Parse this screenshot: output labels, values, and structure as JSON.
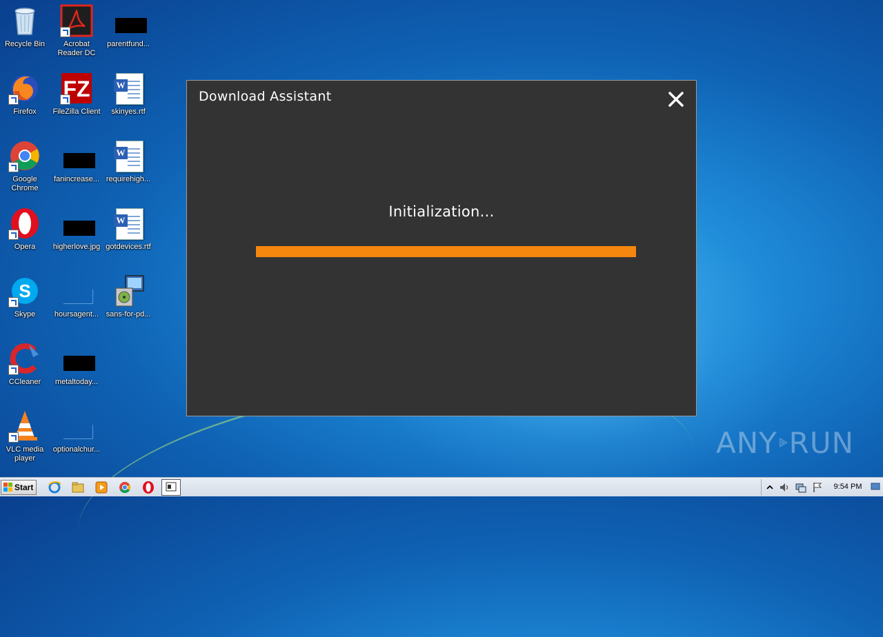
{
  "desktop": {
    "icons": [
      {
        "label": "Recycle Bin",
        "label2": ""
      },
      {
        "label": "Acrobat",
        "label2": "Reader DC"
      },
      {
        "label": "parentfund...",
        "label2": ""
      },
      {
        "label": "Firefox",
        "label2": ""
      },
      {
        "label": "FileZilla Client",
        "label2": ""
      },
      {
        "label": "skinyes.rtf",
        "label2": ""
      },
      {
        "label": "Google",
        "label2": "Chrome"
      },
      {
        "label": "fanincrease...",
        "label2": ""
      },
      {
        "label": "requirehigh...",
        "label2": ""
      },
      {
        "label": "Opera",
        "label2": ""
      },
      {
        "label": "higherlove.jpg",
        "label2": ""
      },
      {
        "label": "gotdevices.rtf",
        "label2": ""
      },
      {
        "label": "Skype",
        "label2": ""
      },
      {
        "label": "hoursagent...",
        "label2": ""
      },
      {
        "label": "sans-for-pd...",
        "label2": ""
      },
      {
        "label": "CCleaner",
        "label2": ""
      },
      {
        "label": "metaltoday...",
        "label2": ""
      },
      {
        "label": "VLC media",
        "label2": "player"
      },
      {
        "label": "optionalchur...",
        "label2": ""
      }
    ]
  },
  "dialog": {
    "title": "Download Assistant",
    "status": "Initialization...",
    "progress_fraction": 1.0,
    "progress_color": "#f5870e",
    "close_icon": "close-icon"
  },
  "watermark": {
    "left": "ANY",
    "right": "RUN"
  },
  "taskbar": {
    "start_label": "Start",
    "clock": "9:54 PM"
  }
}
